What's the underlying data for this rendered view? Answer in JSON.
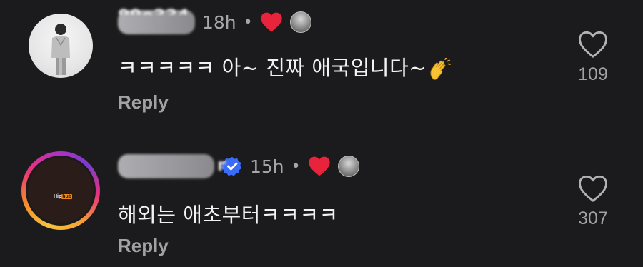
{
  "comments": [
    {
      "username_partial": "99o334",
      "time": "18h",
      "separator": "•",
      "text": "ㅋㅋㅋㅋㅋ 아~ 진짜 애국입니다~",
      "reply_label": "Reply",
      "like_count": "109"
    },
    {
      "username_partial": "r",
      "time": "15h",
      "separator": "•",
      "text": "해외는 애초부터ㅋㅋㅋㅋ",
      "reply_label": "Reply",
      "like_count": "307",
      "avatar_brand": {
        "part1": "Hip",
        "part2": "hub"
      }
    }
  ],
  "colors": {
    "background": "#1b1b1d",
    "text": "#f2f2f2",
    "muted": "#a2a2a5",
    "heart": "#e8243c",
    "verified": "#3b6cf6"
  },
  "icons": {
    "like": "heart-outline-icon",
    "author_liked": "heart-filled-icon",
    "verified": "verified-badge-icon",
    "emoji": "clapping-hands-emoji"
  }
}
